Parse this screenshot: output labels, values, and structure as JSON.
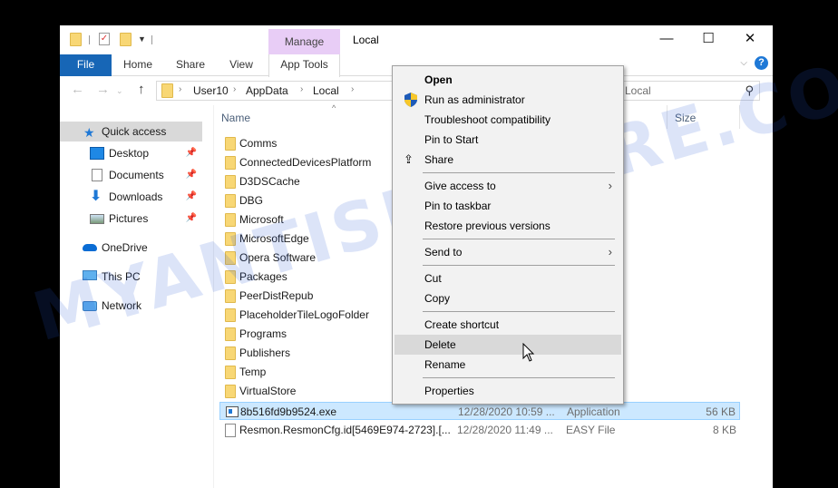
{
  "window": {
    "title": "Local",
    "contextual_tab_group": "Manage",
    "caption": {
      "minimize": "—",
      "maximize": "☐",
      "close": "✕"
    }
  },
  "ribbon": {
    "tabs": [
      {
        "label": "File"
      },
      {
        "label": "Home"
      },
      {
        "label": "Share"
      },
      {
        "label": "View"
      },
      {
        "label": "App Tools"
      }
    ]
  },
  "address": {
    "crumbs": [
      "User10",
      "AppData",
      "Local"
    ],
    "search_placeholder": "Search Local",
    "search_visible": "Local"
  },
  "navpane": {
    "items": [
      {
        "label": "Quick access",
        "icon": "star-icon",
        "selected": true
      },
      {
        "label": "Desktop",
        "icon": "desktop-icon",
        "pinned": true
      },
      {
        "label": "Documents",
        "icon": "documents-icon",
        "pinned": true
      },
      {
        "label": "Downloads",
        "icon": "downloads-icon",
        "pinned": true
      },
      {
        "label": "Pictures",
        "icon": "pictures-icon",
        "pinned": true
      },
      {
        "label": "OneDrive",
        "icon": "onedrive-icon"
      },
      {
        "label": "This PC",
        "icon": "this-pc-icon"
      },
      {
        "label": "Network",
        "icon": "network-icon"
      }
    ]
  },
  "columns": {
    "name": "Name",
    "size": "Size"
  },
  "files": [
    {
      "name": "Comms",
      "kind": "folder"
    },
    {
      "name": "ConnectedDevicesPlatform",
      "kind": "folder"
    },
    {
      "name": "D3DSCache",
      "kind": "folder"
    },
    {
      "name": "DBG",
      "kind": "folder"
    },
    {
      "name": "Microsoft",
      "kind": "folder"
    },
    {
      "name": "MicrosoftEdge",
      "kind": "folder"
    },
    {
      "name": "Opera Software",
      "kind": "folder"
    },
    {
      "name": "Packages",
      "kind": "folder"
    },
    {
      "name": "PeerDistRepub",
      "kind": "folder"
    },
    {
      "name": "PlaceholderTileLogoFolder",
      "kind": "folder"
    },
    {
      "name": "Programs",
      "kind": "folder"
    },
    {
      "name": "Publishers",
      "kind": "folder"
    },
    {
      "name": "Temp",
      "kind": "folder"
    },
    {
      "name": "VirtualStore",
      "kind": "folder"
    },
    {
      "name": "8b516fd9b9524.exe",
      "kind": "app",
      "date": "12/28/2020 10:59 ...",
      "type": "Application",
      "size": "56 KB",
      "selected": true
    },
    {
      "name": "Resmon.ResmonCfg.id[5469E974-2723].[...",
      "kind": "file",
      "date": "12/28/2020 11:49 ...",
      "type": "EASY File",
      "size": "8 KB"
    }
  ],
  "context_menu": {
    "items": [
      {
        "label": "Open",
        "bold": true
      },
      {
        "label": "Run as administrator",
        "icon": "uac-shield-icon"
      },
      {
        "label": "Troubleshoot compatibility"
      },
      {
        "label": "Pin to Start"
      },
      {
        "label": "Share",
        "icon": "share-icon"
      },
      {
        "separator": true
      },
      {
        "label": "Give access to",
        "submenu": true
      },
      {
        "label": "Pin to taskbar"
      },
      {
        "label": "Restore previous versions"
      },
      {
        "separator": true
      },
      {
        "label": "Send to",
        "submenu": true
      },
      {
        "separator": true
      },
      {
        "label": "Cut"
      },
      {
        "label": "Copy"
      },
      {
        "separator": true
      },
      {
        "label": "Create shortcut"
      },
      {
        "label": "Delete",
        "hover": true
      },
      {
        "label": "Rename"
      },
      {
        "separator": true
      },
      {
        "label": "Properties"
      }
    ]
  },
  "watermark": "MYANTISPYWARE.COM"
}
